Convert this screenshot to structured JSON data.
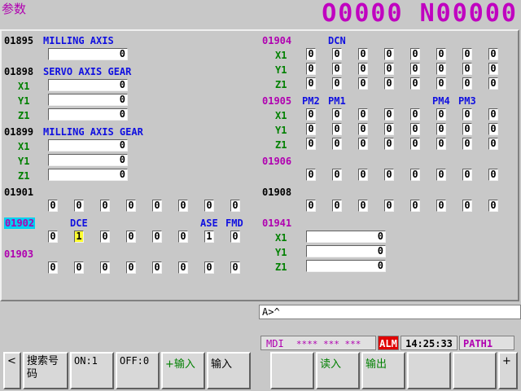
{
  "header": {
    "title": "参数",
    "program": "O0000 N00000"
  },
  "left": {
    "p1895": {
      "num": "01895",
      "label": "MILLING AXIS",
      "value": "0"
    },
    "p1898": {
      "num": "01898",
      "label": "SERVO AXIS GEAR",
      "rows": [
        {
          "axis": "X1",
          "value": "0"
        },
        {
          "axis": "Y1",
          "value": "0"
        },
        {
          "axis": "Z1",
          "value": "0"
        }
      ]
    },
    "p1899": {
      "num": "01899",
      "label": "MILLING AXIS GEAR",
      "rows": [
        {
          "axis": "X1",
          "value": "0"
        },
        {
          "axis": "Y1",
          "value": "0"
        },
        {
          "axis": "Z1",
          "value": "0"
        }
      ]
    },
    "p1901": {
      "num": "01901",
      "bits": [
        "0",
        "0",
        "0",
        "0",
        "0",
        "0",
        "0",
        "0"
      ]
    },
    "p1902": {
      "num": "01902",
      "labels": [
        "DCE",
        "ASE",
        "FMD"
      ],
      "bits": [
        "0",
        "1",
        "0",
        "0",
        "0",
        "0",
        "1",
        "0"
      ]
    },
    "p1903": {
      "num": "01903",
      "bits": [
        "0",
        "0",
        "0",
        "0",
        "0",
        "0",
        "0",
        "0"
      ]
    }
  },
  "right": {
    "p1904": {
      "num": "01904",
      "labels": [
        "DCN"
      ],
      "rows": [
        {
          "axis": "X1",
          "bits": [
            "0",
            "0",
            "0",
            "0",
            "0",
            "0",
            "0",
            "0"
          ]
        },
        {
          "axis": "Y1",
          "bits": [
            "0",
            "0",
            "0",
            "0",
            "0",
            "0",
            "0",
            "0"
          ]
        },
        {
          "axis": "Z1",
          "bits": [
            "0",
            "0",
            "0",
            "0",
            "0",
            "0",
            "0",
            "0"
          ]
        }
      ]
    },
    "p1905": {
      "num": "01905",
      "labels": [
        "PM2",
        "PM1",
        "PM4",
        "PM3"
      ],
      "rows": [
        {
          "axis": "X1",
          "bits": [
            "0",
            "0",
            "0",
            "0",
            "0",
            "0",
            "0",
            "0"
          ]
        },
        {
          "axis": "Y1",
          "bits": [
            "0",
            "0",
            "0",
            "0",
            "0",
            "0",
            "0",
            "0"
          ]
        },
        {
          "axis": "Z1",
          "bits": [
            "0",
            "0",
            "0",
            "0",
            "0",
            "0",
            "0",
            "0"
          ]
        }
      ]
    },
    "p1906": {
      "num": "01906",
      "bits": [
        "0",
        "0",
        "0",
        "0",
        "0",
        "0",
        "0",
        "0"
      ]
    },
    "p1908": {
      "num": "01908",
      "bits": [
        "0",
        "0",
        "0",
        "0",
        "0",
        "0",
        "0",
        "0"
      ]
    },
    "p1941": {
      "num": "01941",
      "rows": [
        {
          "axis": "X1",
          "value": "0"
        },
        {
          "axis": "Y1",
          "value": "0"
        },
        {
          "axis": "Z1",
          "value": "0"
        }
      ]
    }
  },
  "input": {
    "prompt": "A>^"
  },
  "status": {
    "mode": "MDI",
    "stars": "**** *** ***",
    "alarm": "ALM",
    "time": "14:25:33",
    "path": "PATH1"
  },
  "softkeys": {
    "left_arrow": "<",
    "search": "搜索号码",
    "on": "ON:1",
    "off": "OFF:0",
    "plus_input": "+输入",
    "input": "输入",
    "read": "读入",
    "output": "输出",
    "right_arrow": "+"
  },
  "colors": {
    "magenta": "#c000c0",
    "blue": "#1010e0",
    "green": "#008000",
    "cursor": "#00d0f0",
    "alarm": "#e00000"
  }
}
